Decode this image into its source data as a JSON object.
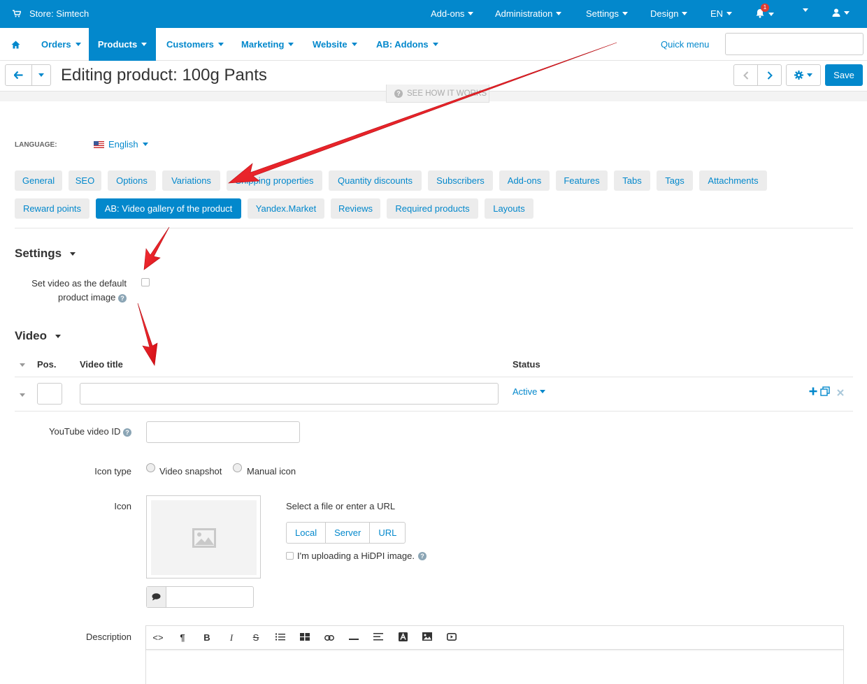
{
  "topbar": {
    "store": "Store: Simtech",
    "menus": [
      "Add-ons",
      "Administration",
      "Settings",
      "Design",
      "EN"
    ],
    "notification_count": "1"
  },
  "nav": {
    "items": [
      "Orders",
      "Products",
      "Customers",
      "Marketing",
      "Website",
      "AB: Addons"
    ],
    "active": "Products",
    "quick_menu": "Quick menu",
    "search_value": ""
  },
  "titlebar": {
    "title": "Editing product: 100g Pants",
    "save": "Save",
    "see_how": "SEE HOW IT WORKS"
  },
  "language": {
    "label": "LANGUAGE:",
    "value": "English"
  },
  "tabs_row1": [
    "General",
    "SEO",
    "Options",
    "Variations",
    "Shipping properties",
    "Quantity discounts",
    "Subscribers",
    "Add-ons",
    "Features",
    "Tabs",
    "Tags",
    "Attachments"
  ],
  "tabs_row2": [
    "Reward points",
    "AB: Video gallery of the product",
    "Yandex.Market",
    "Reviews",
    "Required products",
    "Layouts"
  ],
  "active_tab": "AB: Video gallery of the product",
  "settings": {
    "heading": "Settings",
    "default_image_label_1": "Set video as the default",
    "default_image_label_2": "product image",
    "default_image_checked": false
  },
  "video": {
    "heading": "Video",
    "col_pos": "Pos.",
    "col_title": "Video title",
    "col_status": "Status",
    "row": {
      "pos": "",
      "title": "",
      "status": "Active"
    },
    "youtube_label": "YouTube video ID",
    "youtube_value": "",
    "icon_type_label": "Icon type",
    "icon_type_options": [
      "Video snapshot",
      "Manual icon"
    ],
    "icon_label": "Icon",
    "select_file_text": "Select a file or enter a URL",
    "upload_buttons": [
      "Local",
      "Server",
      "URL"
    ],
    "hidpi_label": "I'm uploading a HiDPI image.",
    "alt_text_value": "",
    "description_label": "Description"
  },
  "colors": {
    "primary": "#0388cc",
    "arrow": "#e8141b",
    "tab_bg": "#ececec"
  }
}
